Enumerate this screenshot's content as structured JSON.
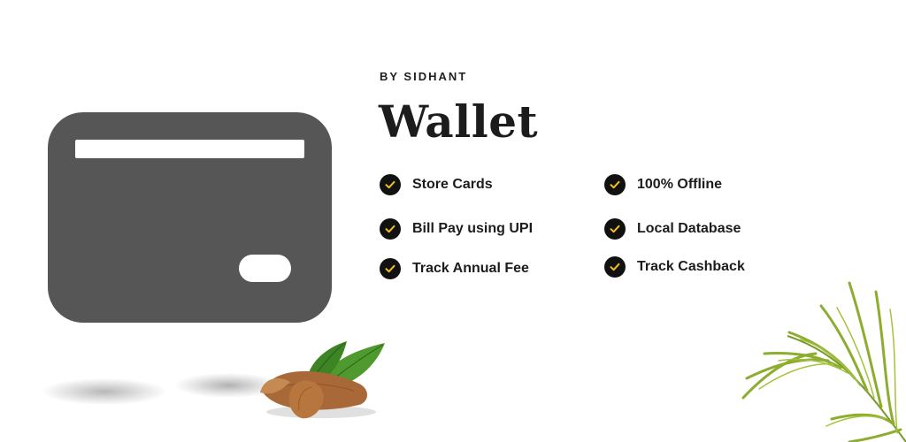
{
  "header": {
    "byline": "BY SIDHANT",
    "title": "Wallet"
  },
  "features": [
    {
      "label": "Store Cards",
      "icon": "check-icon"
    },
    {
      "label": "100% Offline",
      "icon": "check-icon"
    },
    {
      "label": "Bill Pay using UPI",
      "icon": "check-icon"
    },
    {
      "label": "Local Database",
      "icon": "check-icon"
    },
    {
      "label": "Track Annual Fee",
      "icon": "check-icon"
    },
    {
      "label": "Track Cashback",
      "icon": "check-icon"
    }
  ],
  "colors": {
    "card": "#565656",
    "check_circle": "#111111",
    "check_mark": "#f2c21a",
    "text": "#1c1c1c"
  }
}
